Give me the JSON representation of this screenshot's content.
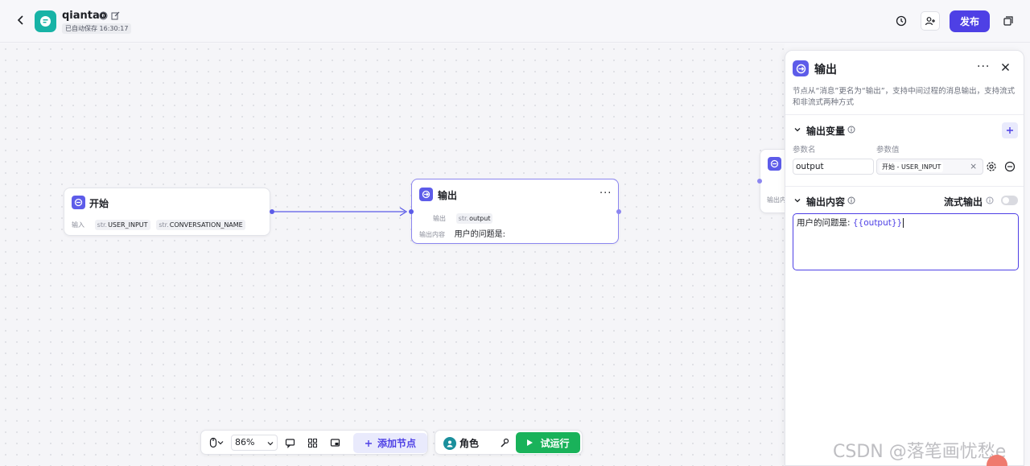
{
  "header": {
    "app_title": "qiantao",
    "autosave": "已自动保存 16:30:17",
    "publish_label": "发布"
  },
  "canvas": {
    "start_node": {
      "title": "开始",
      "input_label": "输入",
      "inputs": [
        {
          "type": "str.",
          "name": "USER_INPUT"
        },
        {
          "type": "str.",
          "name": "CONVERSATION_NAME"
        }
      ]
    },
    "output_node": {
      "title": "输出",
      "output_label": "输出",
      "output_type": "str.",
      "output_name": "output",
      "content_label": "输出内容",
      "content_value": "用户的问题是:"
    },
    "partial_node": {
      "label_fragment": "输出内"
    }
  },
  "toolbar": {
    "zoom": "86%",
    "add_node_label": "添加节点",
    "role_label": "角色",
    "trial_run_label": "试运行"
  },
  "panel": {
    "title": "输出",
    "description": "节点从“消息”更名为“输出”，支持中间过程的消息输出，支持流式和非流式两种方式",
    "variables_section": "输出变量",
    "param_name_label": "参数名",
    "param_value_label": "参数值",
    "param_name_value": "output",
    "param_value_source": "开始 - USER_INPUT",
    "content_section": "输出内容",
    "streaming_label": "流式输出",
    "content_text": "用户的问题是: ",
    "content_variable": "{{output}}",
    "streaming_enabled": false
  },
  "watermark": "CSDN @落笔画忧愁e",
  "colors": {
    "brand": "#4e40e5",
    "node_icon": "#5d5ce9",
    "app_logo": "#18b3a6",
    "trial_green": "#19b25a"
  }
}
